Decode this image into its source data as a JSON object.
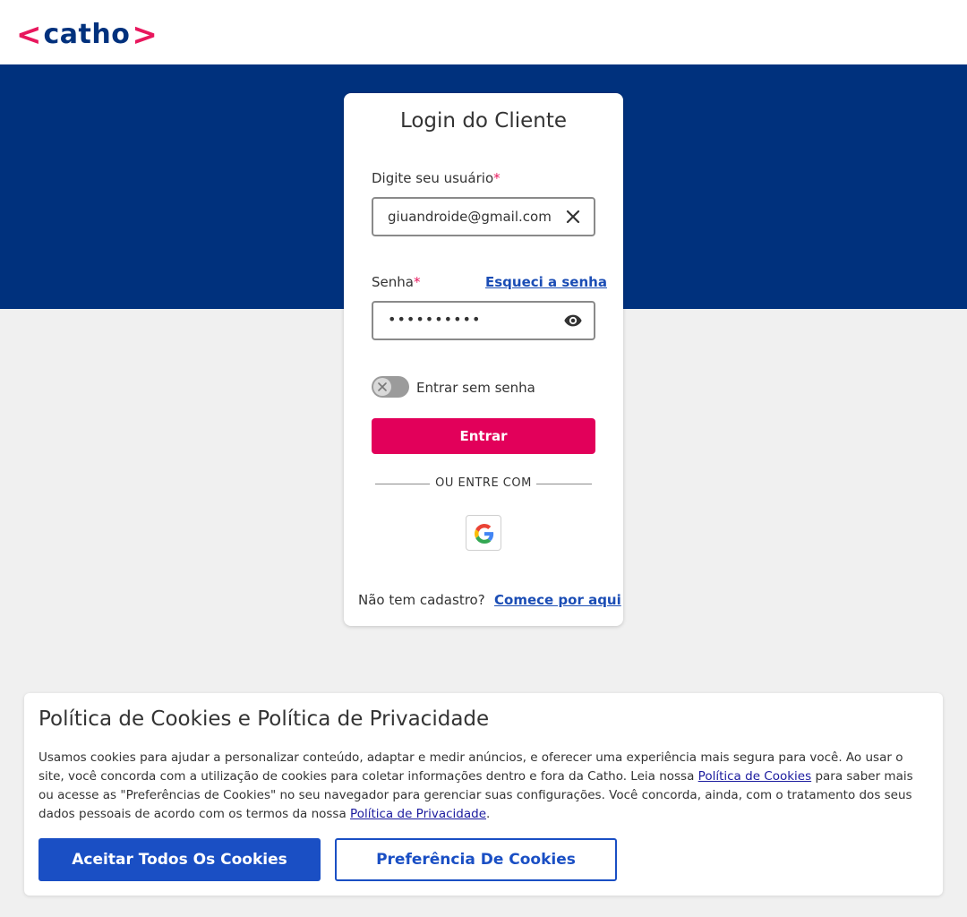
{
  "header": {
    "logo_text": "catho",
    "logo_left": "<",
    "logo_right": ">"
  },
  "login": {
    "title": "Login do Cliente",
    "username_label": "Digite seu usuário",
    "required_mark": "*",
    "username_value": "giuandroide@gmail.com",
    "password_label": "Senha",
    "forgot_link": "Esqueci a senha",
    "password_value": "••••••••••",
    "passwordless_label": "Entrar sem senha",
    "passwordless_enabled": false,
    "submit_label": "Entrar",
    "or_text": "OU ENTRE COM",
    "no_account_text": "Não tem cadastro?",
    "signup_link": "Comece por aqui"
  },
  "cookies": {
    "title": "Política de Cookies e Política de Privacidade",
    "text_part1": "Usamos cookies para ajudar a personalizar conteúdo, adaptar e medir anúncios, e oferecer uma experiência mais segura para você. Ao usar o site, você concorda com a utilização de cookies para coletar informações dentro e fora da Catho. Leia nossa ",
    "cookie_policy_link": "Política de Cookies",
    "text_part2": " para saber mais ou acesse as \"Preferências de Cookies\" no seu navegador para gerenciar suas configurações. Você concorda, ainda, com o tratamento dos seus dados pessoais de acordo com os termos da nossa ",
    "privacy_policy_link": "Política de Privacidade",
    "text_part3": ".",
    "accept_label": "Aceitar Todos Os Cookies",
    "preferences_label": "Preferência De Cookies"
  },
  "colors": {
    "brand_blue": "#00317d",
    "brand_pink": "#e2005a",
    "link_blue": "#1b4db5",
    "cookie_button_blue": "#1a4fc4"
  },
  "icons": {
    "clear": "close-icon",
    "password": "eye-icon",
    "google": "google-icon",
    "toggle": "x-icon"
  }
}
